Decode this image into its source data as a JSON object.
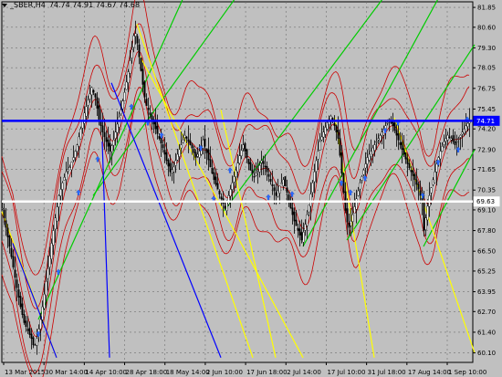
{
  "header": {
    "symbol": "_SBER,H4",
    "ohlc": "74.74 74.91 74.67 74.68"
  },
  "chart_data": {
    "type": "candlestick",
    "symbol": "_SBER",
    "timeframe": "H4",
    "ylim": [
      59.5,
      82.2
    ],
    "y_ticks": [
      "81.85",
      "80.60",
      "79.30",
      "78.05",
      "76.75",
      "75.45",
      "74.20",
      "72.90",
      "71.65",
      "70.35",
      "69.10",
      "67.80",
      "66.50",
      "65.25",
      "63.95",
      "62.70",
      "61.40",
      "60.10"
    ],
    "x_ticks": [
      "13 Mar 2015",
      "30 Mar 14:00",
      "14 Apr 10:00",
      "28 Apr 18:00",
      "18 May 14:00",
      "2 Jun 10:00",
      "17 Jun 18:00",
      "2 Jul 14:00",
      "17 Jul 10:00",
      "31 Jul 18:00",
      "17 Aug 14:00",
      "1 Sep 10:00"
    ],
    "price_labels": [
      {
        "name": "blue-level",
        "value": "74.71",
        "color": "#0000ff"
      },
      {
        "name": "white-level",
        "value": "69.63",
        "color": "#ffffff"
      }
    ],
    "close_path": [
      [
        0,
        69.2
      ],
      [
        4,
        68.0
      ],
      [
        8,
        66.8
      ],
      [
        12,
        65.5
      ],
      [
        16,
        64.2
      ],
      [
        20,
        63.0
      ],
      [
        24,
        62.0
      ],
      [
        28,
        61.5
      ],
      [
        32,
        61.0
      ],
      [
        35,
        60.4
      ],
      [
        38,
        61.0
      ],
      [
        42,
        62.2
      ],
      [
        46,
        63.8
      ],
      [
        50,
        65.4
      ],
      [
        54,
        67.0
      ],
      [
        58,
        68.6
      ],
      [
        62,
        70.0
      ],
      [
        66,
        70.8
      ],
      [
        70,
        71.5
      ],
      [
        74,
        71.8
      ],
      [
        78,
        72.4
      ],
      [
        82,
        73.2
      ],
      [
        86,
        74.2
      ],
      [
        90,
        75.2
      ],
      [
        94,
        76.0
      ],
      [
        98,
        76.8
      ],
      [
        102,
        76.2
      ],
      [
        106,
        74.8
      ],
      [
        110,
        74.0
      ],
      [
        114,
        73.4
      ],
      [
        118,
        72.8
      ],
      [
        122,
        73.5
      ],
      [
        126,
        74.5
      ],
      [
        130,
        75.4
      ],
      [
        134,
        76.5
      ],
      [
        138,
        77.8
      ],
      [
        142,
        79.2
      ],
      [
        145,
        80.5
      ],
      [
        148,
        79.6
      ],
      [
        151,
        78.3
      ],
      [
        154,
        77.0
      ],
      [
        157,
        75.8
      ],
      [
        160,
        75.4
      ],
      [
        164,
        74.8
      ],
      [
        168,
        74.2
      ],
      [
        172,
        73.6
      ],
      [
        176,
        73.0
      ],
      [
        180,
        72.2
      ],
      [
        184,
        71.5
      ],
      [
        188,
        71.8
      ],
      [
        192,
        72.6
      ],
      [
        196,
        73.2
      ],
      [
        200,
        73.8
      ],
      [
        204,
        73.4
      ],
      [
        208,
        73.0
      ],
      [
        212,
        72.4
      ],
      [
        216,
        72.8
      ],
      [
        220,
        73.5
      ],
      [
        224,
        72.7
      ],
      [
        228,
        71.8
      ],
      [
        232,
        71.0
      ],
      [
        236,
        70.4
      ],
      [
        240,
        69.8
      ],
      [
        244,
        69.2
      ],
      [
        248,
        70.0
      ],
      [
        252,
        70.8
      ],
      [
        256,
        71.6
      ],
      [
        260,
        72.5
      ],
      [
        264,
        73.2
      ],
      [
        268,
        72.4
      ],
      [
        272,
        71.6
      ],
      [
        276,
        71.2
      ],
      [
        280,
        71.6
      ],
      [
        284,
        72.2
      ],
      [
        288,
        71.8
      ],
      [
        292,
        71.2
      ],
      [
        296,
        70.6
      ],
      [
        300,
        70.0
      ],
      [
        304,
        70.6
      ],
      [
        308,
        71.0
      ],
      [
        312,
        70.2
      ],
      [
        316,
        69.2
      ],
      [
        320,
        68.4
      ],
      [
        324,
        67.8
      ],
      [
        328,
        67.2
      ],
      [
        332,
        68.2
      ],
      [
        336,
        69.4
      ],
      [
        340,
        70.8
      ],
      [
        344,
        72.2
      ],
      [
        348,
        73.4
      ],
      [
        352,
        74.0
      ],
      [
        356,
        74.6
      ],
      [
        360,
        75.0
      ],
      [
        364,
        74.4
      ],
      [
        368,
        73.6
      ],
      [
        371,
        72.0
      ],
      [
        374,
        70.2
      ],
      [
        377,
        68.5
      ],
      [
        380,
        68.0
      ],
      [
        384,
        68.8
      ],
      [
        388,
        69.8
      ],
      [
        392,
        70.8
      ],
      [
        396,
        71.6
      ],
      [
        400,
        72.4
      ],
      [
        404,
        72.8
      ],
      [
        408,
        73.2
      ],
      [
        412,
        73.6
      ],
      [
        416,
        74.0
      ],
      [
        420,
        74.4
      ],
      [
        424,
        74.8
      ],
      [
        428,
        74.4
      ],
      [
        432,
        73.8
      ],
      [
        436,
        73.2
      ],
      [
        440,
        72.6
      ],
      [
        444,
        72.0
      ],
      [
        448,
        71.5
      ],
      [
        452,
        71.0
      ],
      [
        456,
        70.4
      ],
      [
        460,
        69.6
      ],
      [
        462,
        67.8
      ],
      [
        465,
        69.0
      ],
      [
        468,
        70.0
      ],
      [
        472,
        71.0
      ],
      [
        476,
        72.0
      ],
      [
        480,
        72.8
      ],
      [
        484,
        73.4
      ],
      [
        488,
        73.8
      ],
      [
        492,
        73.6
      ],
      [
        496,
        73.2
      ],
      [
        500,
        73.6
      ],
      [
        504,
        74.0
      ],
      [
        508,
        74.4
      ],
      [
        512,
        74.7
      ]
    ],
    "band_offsets": [
      2.2,
      3.5
    ],
    "arrow_marks": [
      [
        40,
        61.3
      ],
      [
        62,
        65.2
      ],
      [
        84,
        70.2
      ],
      [
        105,
        72.3
      ],
      [
        142,
        75.6
      ],
      [
        160,
        74.6
      ],
      [
        175,
        73.8
      ],
      [
        218,
        73.0
      ],
      [
        232,
        69.8
      ],
      [
        250,
        71.6
      ],
      [
        292,
        69.9
      ],
      [
        318,
        70.1
      ],
      [
        372,
        70.8
      ],
      [
        382,
        70.2
      ],
      [
        398,
        71.1
      ],
      [
        420,
        74.1
      ],
      [
        434,
        74.6
      ],
      [
        461,
        70.0
      ],
      [
        478,
        72.1
      ],
      [
        500,
        72.9
      ],
      [
        510,
        74.8
      ]
    ],
    "colors": {
      "background": "#c0c0c0",
      "grid": "#707070",
      "candle": "#000000",
      "bands": "#cc0000",
      "green_lines": "#00cc00",
      "yellow_lines": "#ffff00",
      "blue_level": "#0000ff",
      "white_level": "#ffffff",
      "arrows": "#2b6bff"
    }
  }
}
